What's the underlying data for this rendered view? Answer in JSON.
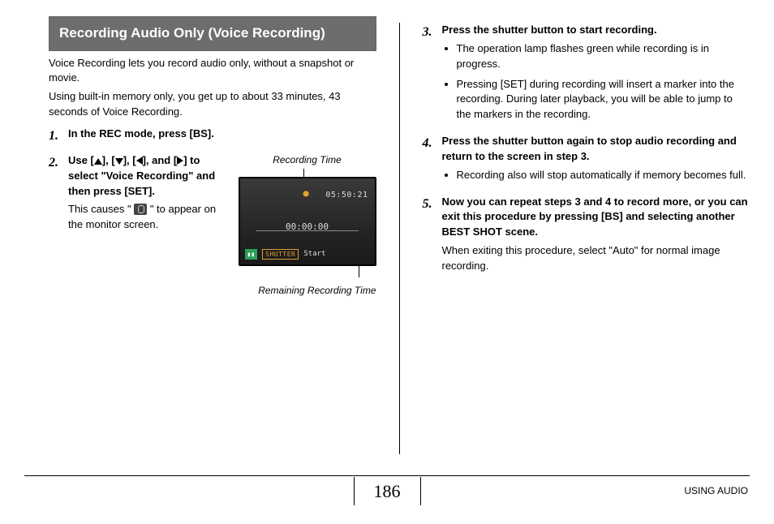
{
  "left": {
    "header": "Recording Audio Only (Voice Recording)",
    "intro1": "Voice Recording lets you record audio only, without a snapshot or movie.",
    "intro2": "Using built-in memory only, you get up to about 33 minutes, 43 seconds of Voice Recording.",
    "step1": "In the REC mode, press [BS].",
    "step2_pre": "Use [",
    "step2_mid1": "], [",
    "step2_mid2": "], [",
    "step2_mid3": "], and [",
    "step2_post": "] to select \"Voice Recording\" and then press [SET].",
    "step2_body_a": "This causes \" ",
    "step2_body_b": " \" to appear on the monitor screen.",
    "fig_top": "Recording Time",
    "fig_bottom": "Remaining Recording Time",
    "screen": {
      "remaining": "05:50:21",
      "elapsed": "00:00:00",
      "shutter": "SHUTTER",
      "start": "Start"
    }
  },
  "right": {
    "step3": "Press the shutter button to start recording.",
    "s3_b1": "The operation lamp flashes green while recording is in progress.",
    "s3_b2": "Pressing [SET] during recording will insert a marker into the recording. During later playback, you will be able to jump to the markers in the recording.",
    "step4": "Press the shutter button again to stop audio recording and return to the screen in step 3.",
    "s4_b1": "Recording also will stop automatically if memory becomes full.",
    "step5": "Now you can repeat steps 3 and 4 to record more, or you can exit this procedure by pressing [BS] and selecting another BEST SHOT scene.",
    "s5_body": "When exiting this procedure, select \"Auto\" for normal image recording."
  },
  "footer": {
    "page": "186",
    "label": "USING AUDIO"
  }
}
